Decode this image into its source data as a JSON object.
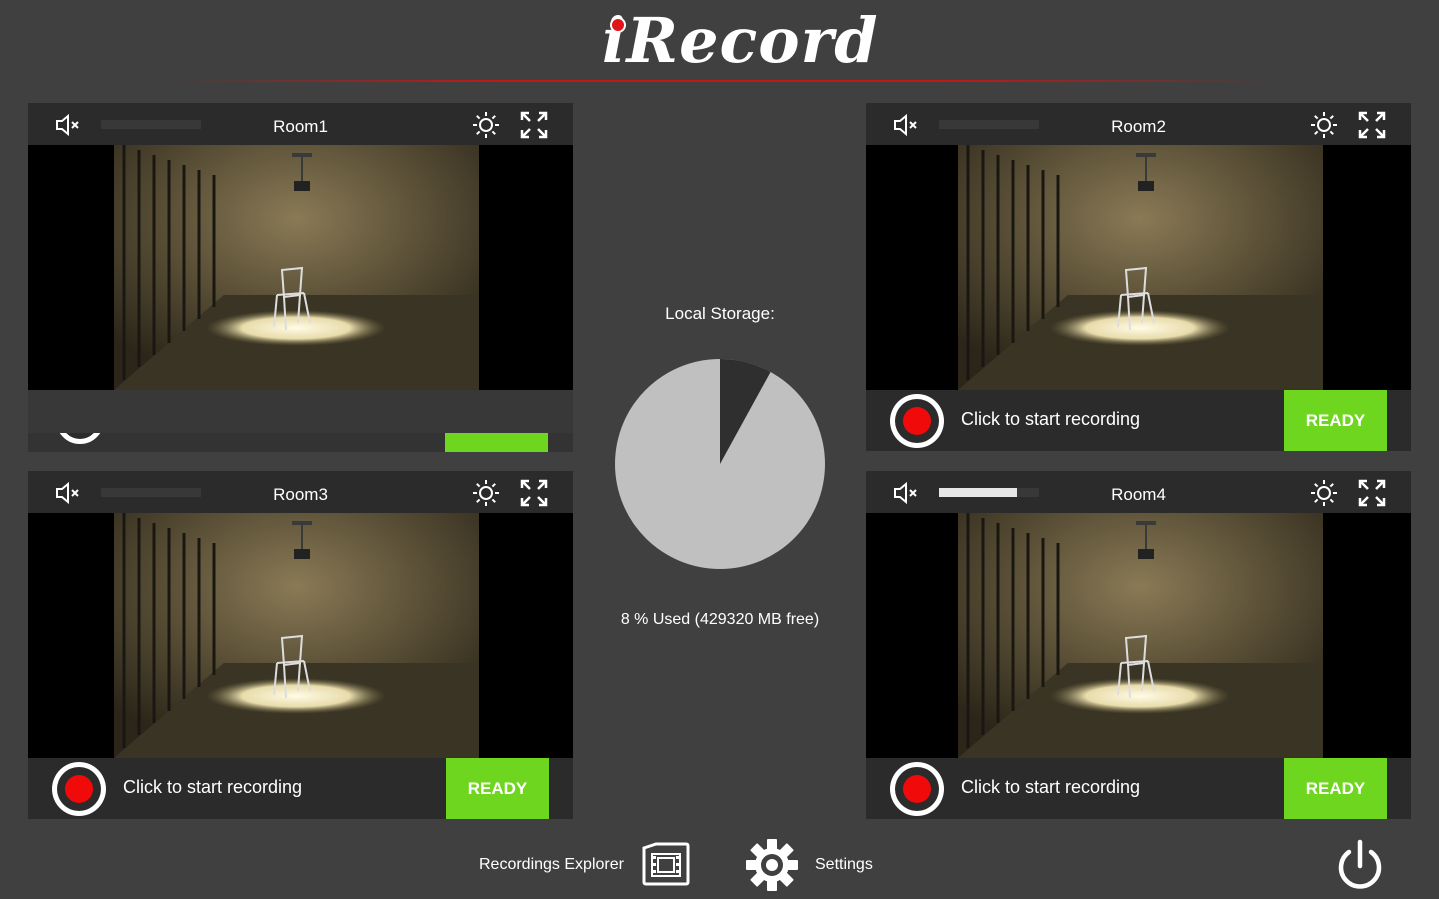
{
  "app": {
    "logo_text": "iRecord",
    "accent_color": "#e1141c"
  },
  "rooms": [
    {
      "name": "Room1",
      "level": 0.0,
      "record_label": "",
      "status": "",
      "collapsed": true
    },
    {
      "name": "Room2",
      "level": 0.0,
      "record_label": "Click to start recording",
      "status": "READY"
    },
    {
      "name": "Room3",
      "level": 0.0,
      "record_label": "Click to start recording",
      "status": "READY"
    },
    {
      "name": "Room4",
      "level": 0.78,
      "record_label": "Click to start recording",
      "status": "READY"
    }
  ],
  "storage": {
    "label": "Local Storage:",
    "used_percent": 8,
    "usage_text": "8 % Used (429320 MB free)"
  },
  "bottom_bar": {
    "explorer_label": "Recordings Explorer",
    "settings_label": "Settings"
  },
  "icons": {
    "mute": "speaker-mute-icon",
    "brightness": "sun-icon",
    "fullscreen": "expand-icon",
    "record": "record-icon",
    "explorer": "film-icon",
    "settings": "gear-icon",
    "power": "power-icon"
  },
  "colors": {
    "ready": "#6ed61e",
    "record": "#f00a0a",
    "background": "#404040",
    "panel": "#2b2b2b"
  }
}
